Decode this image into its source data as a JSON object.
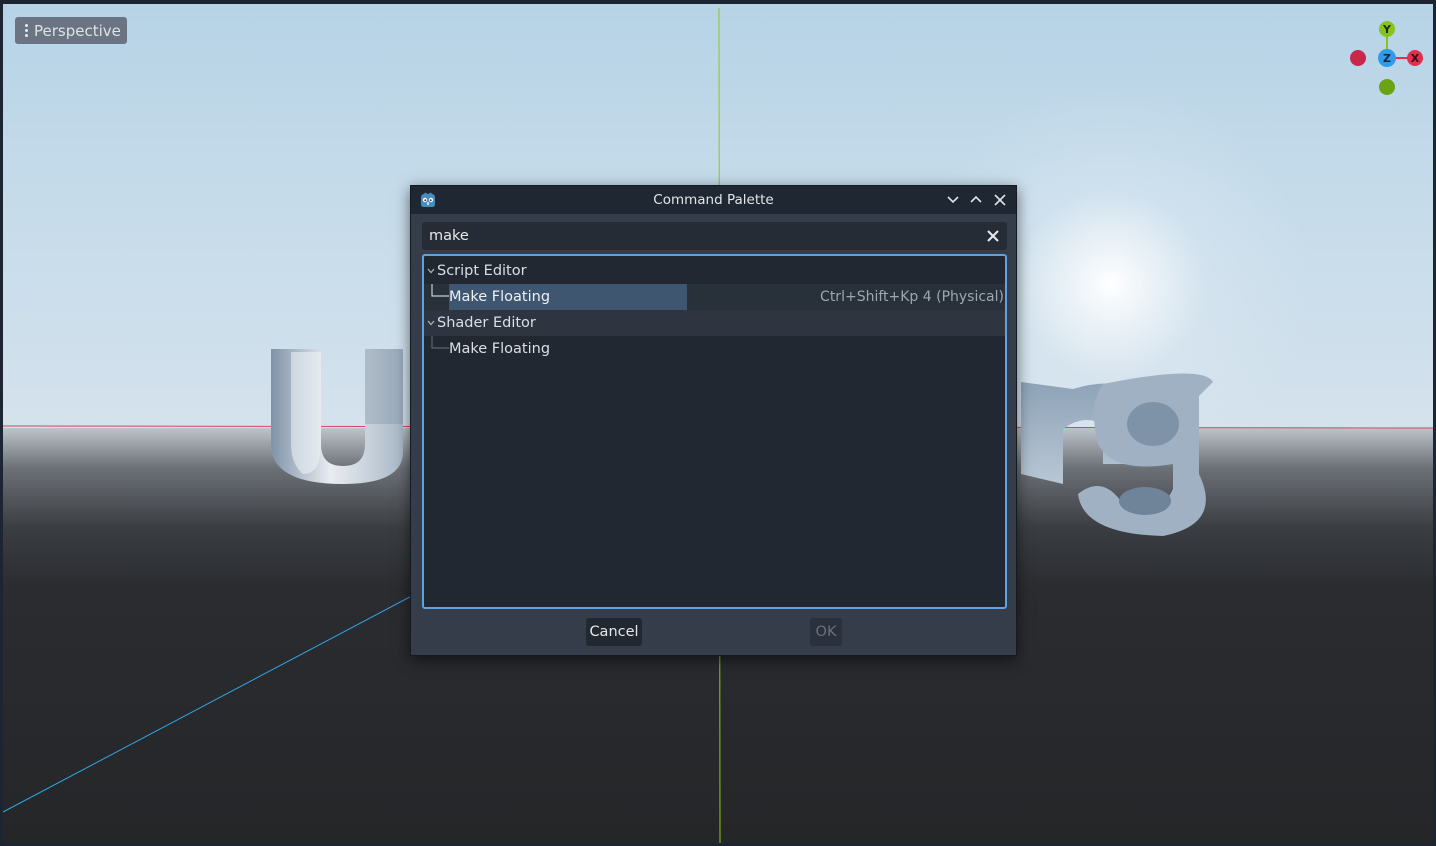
{
  "viewport": {
    "mode_label": "Perspective",
    "axis_gizmo": {
      "y": "Y",
      "z": "Z",
      "x": "X"
    },
    "colors": {
      "x_axis": "#e0304f",
      "y_axis": "#86c41b",
      "z_axis": "#2e9ce8"
    }
  },
  "dialog": {
    "title": "Command Palette",
    "search": {
      "value": "make"
    },
    "groups": [
      {
        "label": "Script Editor",
        "items": [
          {
            "label": "Make Floating",
            "shortcut": "Ctrl+Shift+Kp 4 (Physical)",
            "selected": true
          }
        ]
      },
      {
        "label": "Shader Editor",
        "items": [
          {
            "label": "Make Floating",
            "shortcut": "",
            "selected": false
          }
        ]
      }
    ],
    "buttons": {
      "cancel": "Cancel",
      "ok": "OK"
    }
  },
  "icons": {
    "app": "godot-logo-icon",
    "minimize": "chevron-down-icon",
    "maximize": "chevron-up-icon",
    "close": "close-icon",
    "clear_search": "clear-icon",
    "menu": "kebab-menu-icon"
  }
}
